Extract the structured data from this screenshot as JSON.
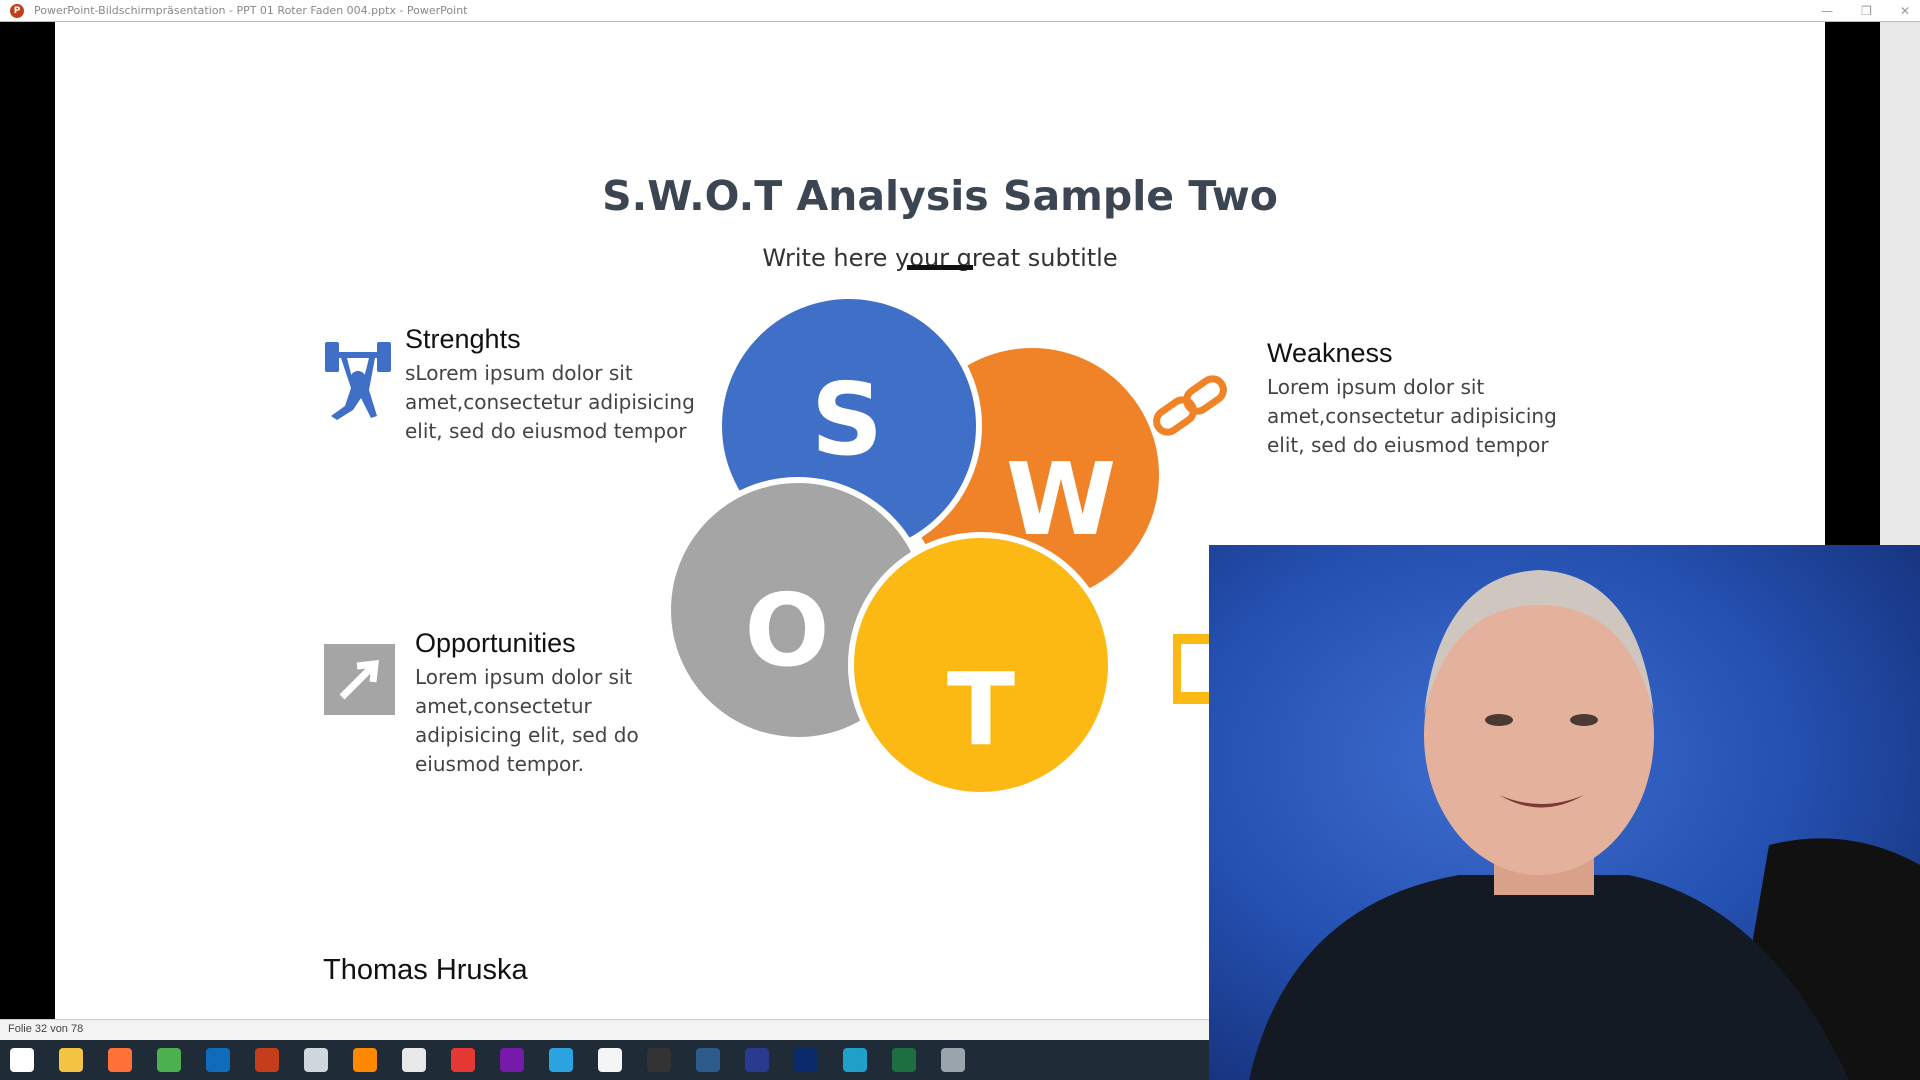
{
  "window": {
    "title": "PowerPoint-Bildschirmpräsentation  -  PPT 01 Roter Faden 004.pptx - PowerPoint",
    "controls": [
      "minimize",
      "restore",
      "close"
    ]
  },
  "slide": {
    "title": "S.W.O.T Analysis Sample Two",
    "subtitle": "Write here your great subtitle",
    "letters": {
      "s": "S",
      "w": "W",
      "o": "O",
      "t": "T"
    },
    "colors": {
      "s": "#3f6fc6",
      "w": "#f08328",
      "o": "#a5a5a5",
      "t": "#fdb913",
      "title": "#3c4552"
    },
    "strengths": {
      "heading": "Strenghts",
      "body": "sLorem ipsum dolor sit amet,consectetur adipisicing elit, sed do eiusmod tempor",
      "icon": "weightlifter-icon"
    },
    "weakness": {
      "heading": "Weakness",
      "body": "Lorem ipsum dolor sit amet,consectetur adipisicing elit, sed do eiusmod tempor",
      "icon": "broken-chain-icon"
    },
    "opportunities": {
      "heading": "Opportunities",
      "body": "Lorem ipsum dolor sit amet,consectetur adipisicing elit, sed do eiusmod tempor.",
      "icon": "arrow-up-right-icon"
    },
    "threats": {
      "icon": "warning-icon"
    },
    "author": "Thomas Hruska"
  },
  "status": {
    "slide_counter": "Folie 32 von 78"
  },
  "taskbar": {
    "icons": [
      {
        "name": "windows-start",
        "color": "#ffffff"
      },
      {
        "name": "file-explorer",
        "color": "#f4c542"
      },
      {
        "name": "firefox",
        "color": "#ff7139"
      },
      {
        "name": "chrome",
        "color": "#4caf50"
      },
      {
        "name": "outlook",
        "color": "#0f6cbd"
      },
      {
        "name": "powerpoint",
        "color": "#c43e1c"
      },
      {
        "name": "snipping",
        "color": "#cfd8dc"
      },
      {
        "name": "vlc",
        "color": "#ff8800"
      },
      {
        "name": "app-orange",
        "color": "#e8e8e8"
      },
      {
        "name": "app-red",
        "color": "#e53935"
      },
      {
        "name": "onenote",
        "color": "#7719aa"
      },
      {
        "name": "telegram",
        "color": "#2aa3e0"
      },
      {
        "name": "app-red-white",
        "color": "#f5f5f5"
      },
      {
        "name": "obs",
        "color": "#333333"
      },
      {
        "name": "app-circle",
        "color": "#2c5a8a"
      },
      {
        "name": "blue-yeti",
        "color": "#2a3b8f"
      },
      {
        "name": "video-app",
        "color": "#0a2a6a"
      },
      {
        "name": "edge",
        "color": "#1fa0c8"
      },
      {
        "name": "excel",
        "color": "#1d6f42"
      },
      {
        "name": "app-gray",
        "color": "#9aa4ad"
      }
    ]
  }
}
